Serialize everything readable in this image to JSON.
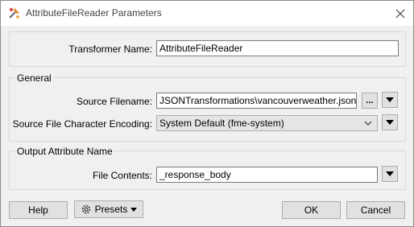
{
  "window": {
    "title": "AttributeFileReader Parameters",
    "app_icon": "fme-transformer-icon",
    "close_icon": "close-icon"
  },
  "transformer": {
    "label": "Transformer Name:",
    "value": "AttributeFileReader"
  },
  "general": {
    "title": "General",
    "source_filename_label": "Source Filename:",
    "source_filename_value": "JSONTransformations\\vancouverweather.json\"",
    "browse_label": "...",
    "encoding_label": "Source File Character Encoding:",
    "encoding_value": "System Default (fme-system)"
  },
  "output": {
    "title": "Output Attribute Name",
    "file_contents_label": "File Contents:",
    "file_contents_value": "_response_body"
  },
  "buttons": {
    "help": "Help",
    "presets": "Presets",
    "ok": "OK",
    "cancel": "Cancel"
  }
}
